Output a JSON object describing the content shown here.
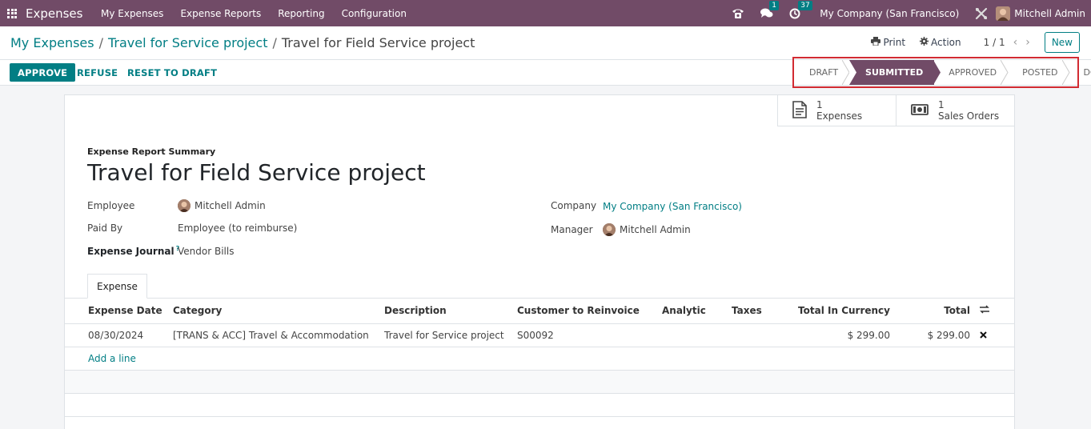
{
  "navbar": {
    "app_name": "Expenses",
    "menu": [
      "My Expenses",
      "Expense Reports",
      "Reporting",
      "Configuration"
    ],
    "messages_badge": "1",
    "activities_badge": "37",
    "company": "My Company (San Francisco)",
    "user": "Mitchell Admin"
  },
  "breadcrumb": {
    "items": [
      "My Expenses",
      "Travel for Service project"
    ],
    "current": "Travel for Field Service project"
  },
  "control": {
    "print_label": "Print",
    "action_label": "Action",
    "pager": "1 / 1",
    "new_label": "New"
  },
  "actions": {
    "approve": "APPROVE",
    "refuse": "REFUSE",
    "reset": "RESET TO DRAFT"
  },
  "stages": {
    "items": [
      "DRAFT",
      "SUBMITTED",
      "APPROVED",
      "POSTED",
      "DONE"
    ],
    "current": "SUBMITTED"
  },
  "smart_buttons": [
    {
      "count": "1",
      "label": "Expenses",
      "icon": "receipt-icon"
    },
    {
      "count": "1",
      "label": "Sales Orders",
      "icon": "money-icon"
    }
  ],
  "form": {
    "summary_label": "Expense Report Summary",
    "title": "Travel for Field Service project",
    "employee_label": "Employee",
    "employee_value": "Mitchell Admin",
    "paid_by_label": "Paid By",
    "paid_by_value": "Employee (to reimburse)",
    "journal_label": "Expense Journal",
    "journal_help": "?",
    "journal_value": "Vendor Bills",
    "company_label": "Company",
    "company_value": "My Company (San Francisco)",
    "manager_label": "Manager",
    "manager_value": "Mitchell Admin"
  },
  "tab": {
    "label": "Expense"
  },
  "lines": {
    "columns": [
      "Expense Date",
      "Category",
      "Description",
      "Customer to Reinvoice",
      "Analytic",
      "Taxes",
      "Total In Currency",
      "Total"
    ],
    "rows": [
      {
        "date": "08/30/2024",
        "category": "[TRANS & ACC] Travel & Accommodation",
        "description": "Travel for Service project",
        "customer": "S00092",
        "analytic": "",
        "taxes": "",
        "total_currency": "$ 299.00",
        "total": "$ 299.00"
      }
    ],
    "add_line": "Add a line"
  },
  "colors": {
    "brand": "#714b67",
    "accent": "#017e84",
    "highlight_box": "#d22b32"
  }
}
